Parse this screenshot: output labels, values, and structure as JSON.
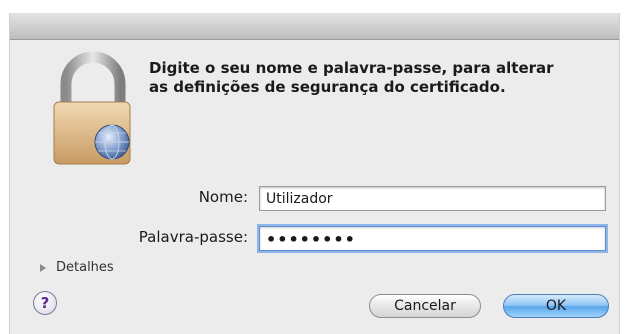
{
  "dialog": {
    "message": "Digite o seu nome e palavra-passe, para alterar as definições de segurança do certificado.",
    "name_label": "Nome:",
    "name_value": "Utilizador",
    "password_label": "Palavra-passe:",
    "password_value": "••••••••",
    "details_label": "Detalhes",
    "help_label": "?",
    "cancel_label": "Cancelar",
    "ok_label": "OK"
  },
  "icons": {
    "lock": "lock-icon",
    "help": "help-icon",
    "disclosure": "disclosure-triangle-icon"
  },
  "colors": {
    "accent": "#5aa5ec",
    "focus_ring": "#8fb4ea",
    "dialog_background": "#ececec"
  }
}
